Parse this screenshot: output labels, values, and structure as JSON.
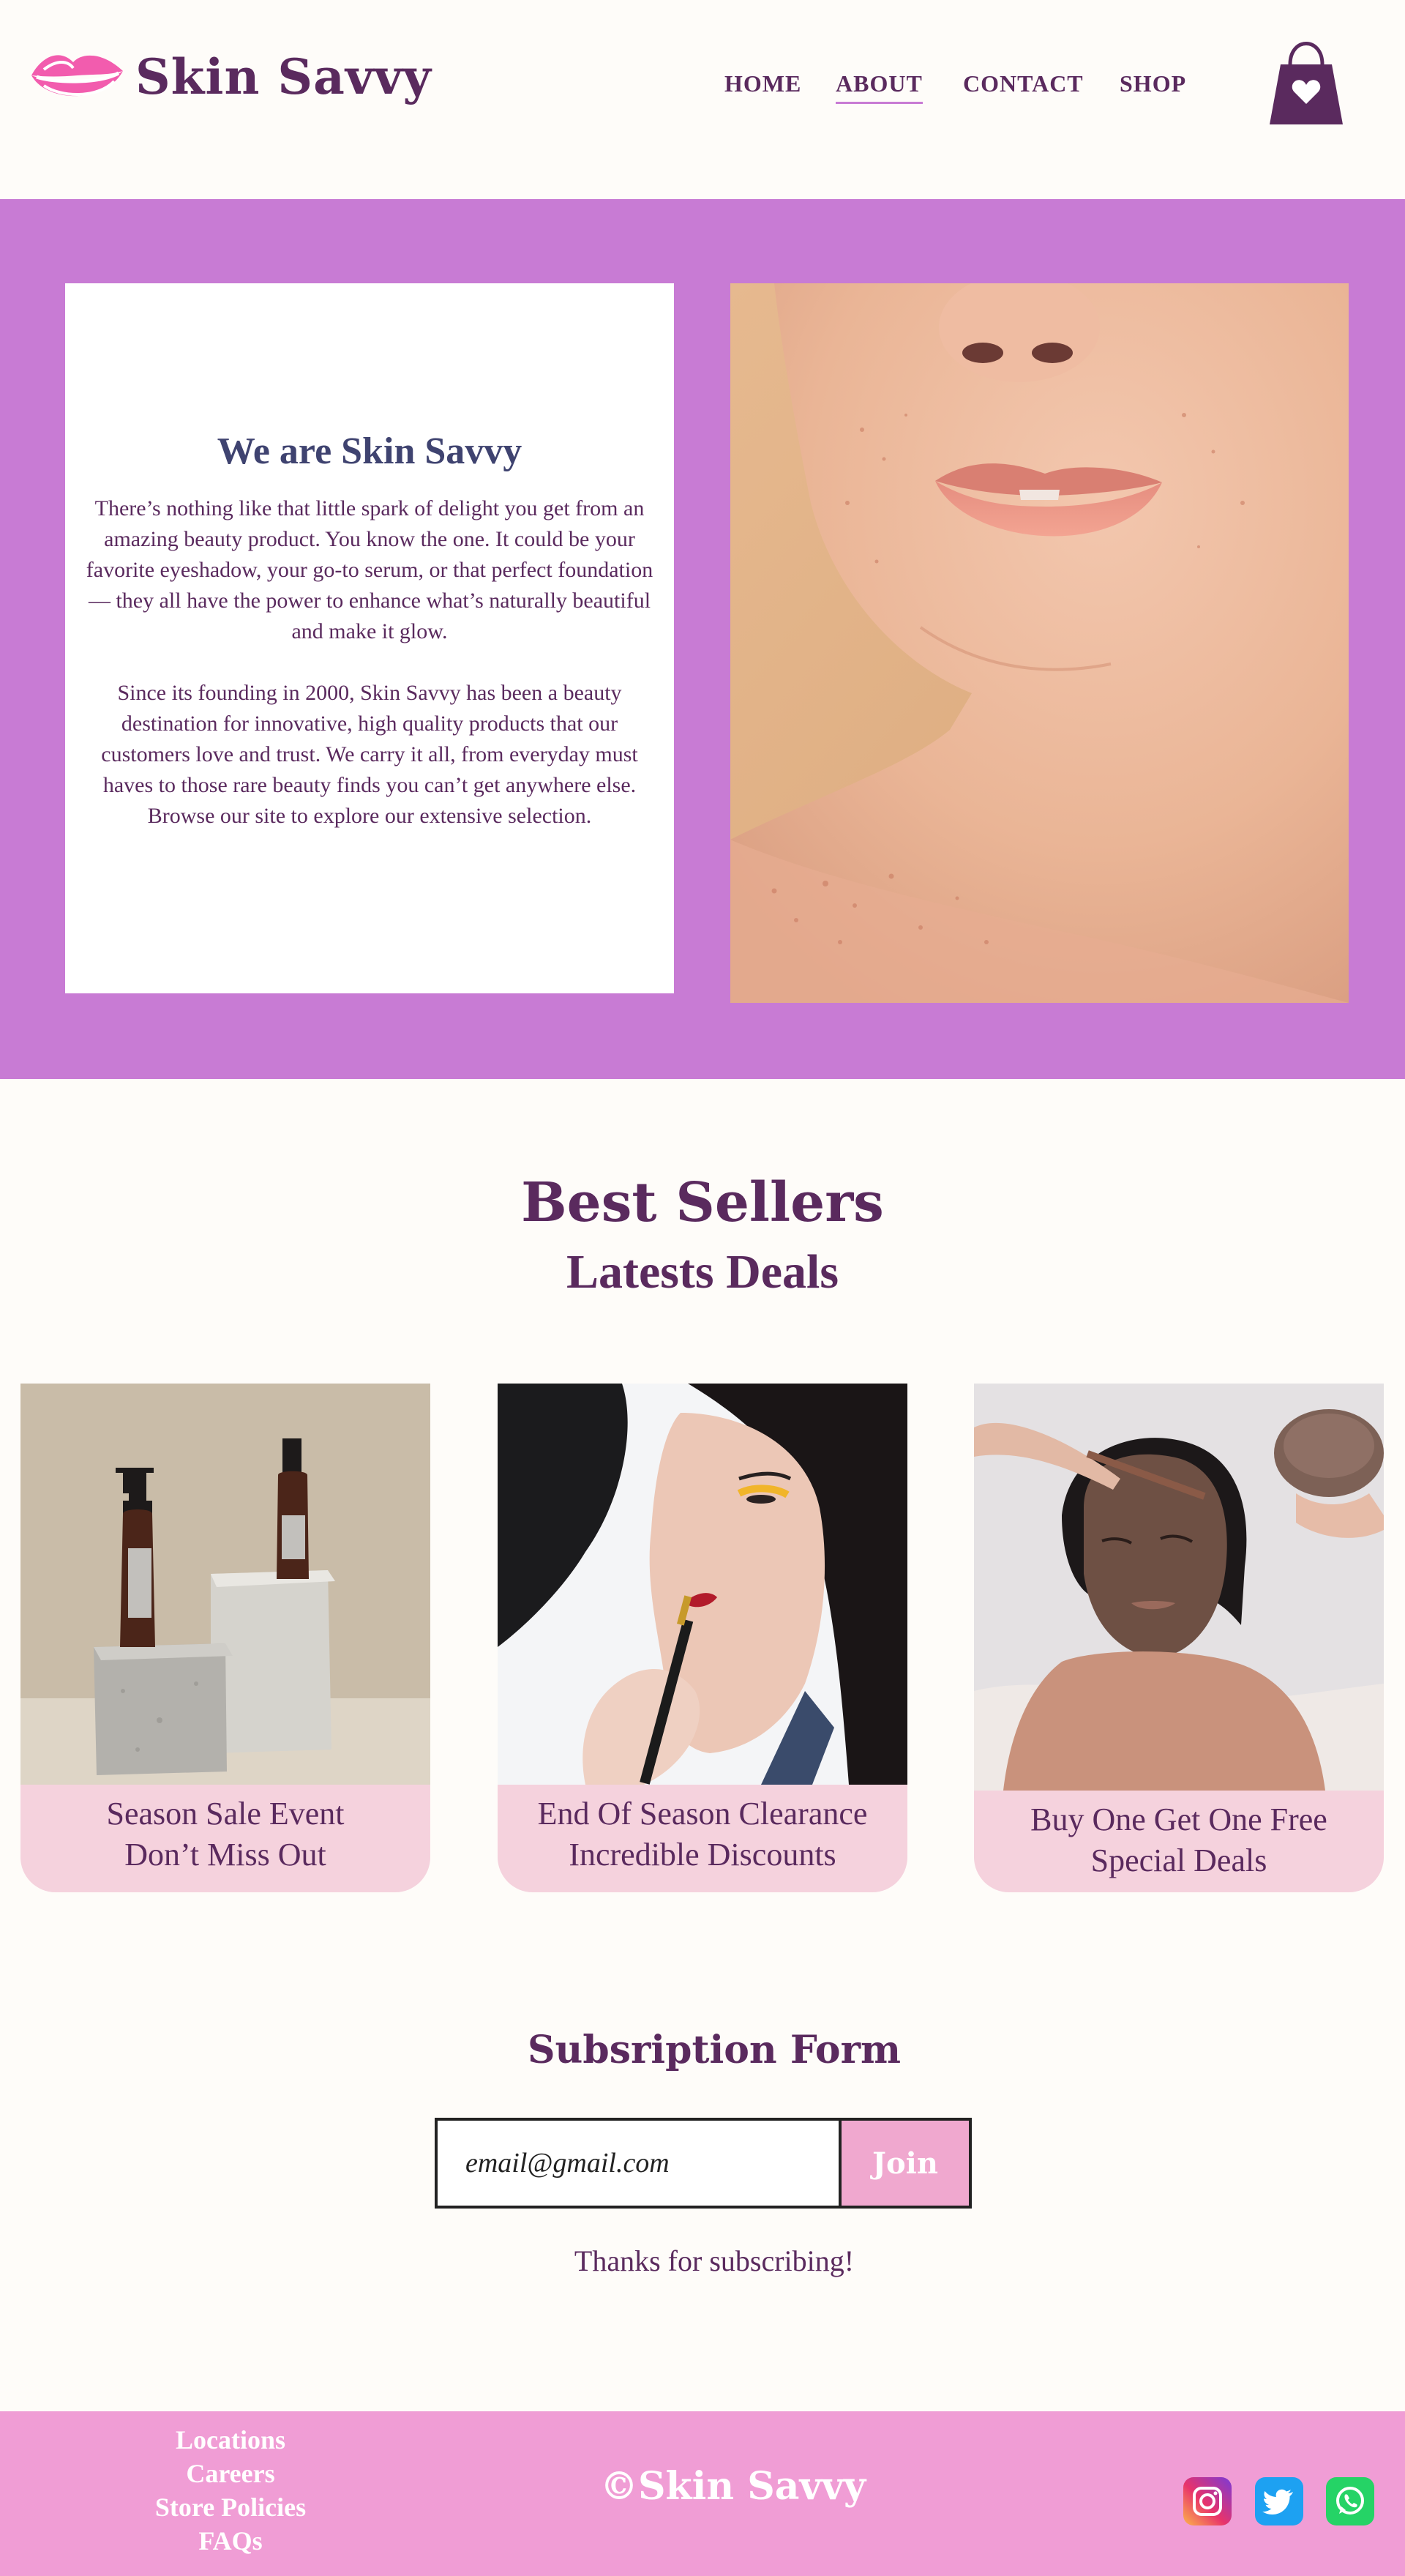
{
  "brand": {
    "name": "Skin Savvy"
  },
  "nav": {
    "home": "HOME",
    "about": "ABOUT",
    "contact": "CONTACT",
    "shop": "SHOP",
    "active": "about"
  },
  "about": {
    "title": "We are Skin Savvy",
    "paragraph1": "There’s nothing like that little spark of delight you get from an amazing beauty product. You know the one. It could be your favorite eyeshadow, your go-to serum, or that perfect foundation — they all have the power to enhance what’s naturally beautiful and make it glow.",
    "paragraph2": "Since its founding in 2000, Skin Savvy has been a beauty destination for innovative, high quality products that our customers love and trust. We carry it all, from everyday must haves to those rare beauty finds you can’t get anywhere else. Browse our site to explore our extensive selection."
  },
  "best_sellers": {
    "title": "Best Sellers",
    "subtitle": "Latests Deals",
    "cards": [
      {
        "line1": "Season Sale Event",
        "line2": "Don’t Miss Out"
      },
      {
        "line1": "End Of  Season Clearance",
        "line2": "Incredible Discounts"
      },
      {
        "line1": "Buy One Get One Free",
        "line2": "Special Deals"
      }
    ]
  },
  "subscription": {
    "title": "Subsription Form",
    "input_value": "email@gmail.com",
    "button": "Join",
    "thanks": "Thanks for subscribing!"
  },
  "footer": {
    "links": [
      "Locations",
      "Careers",
      "Store Policies",
      "FAQs"
    ],
    "copyright": "©Skin Savvy"
  },
  "colors": {
    "brand_purple": "#5a2a5e",
    "about_bg": "#c87bd4",
    "card_pink": "#f5d2dd",
    "footer_pink": "#f09dd5",
    "logo_pink": "#f25cae"
  }
}
